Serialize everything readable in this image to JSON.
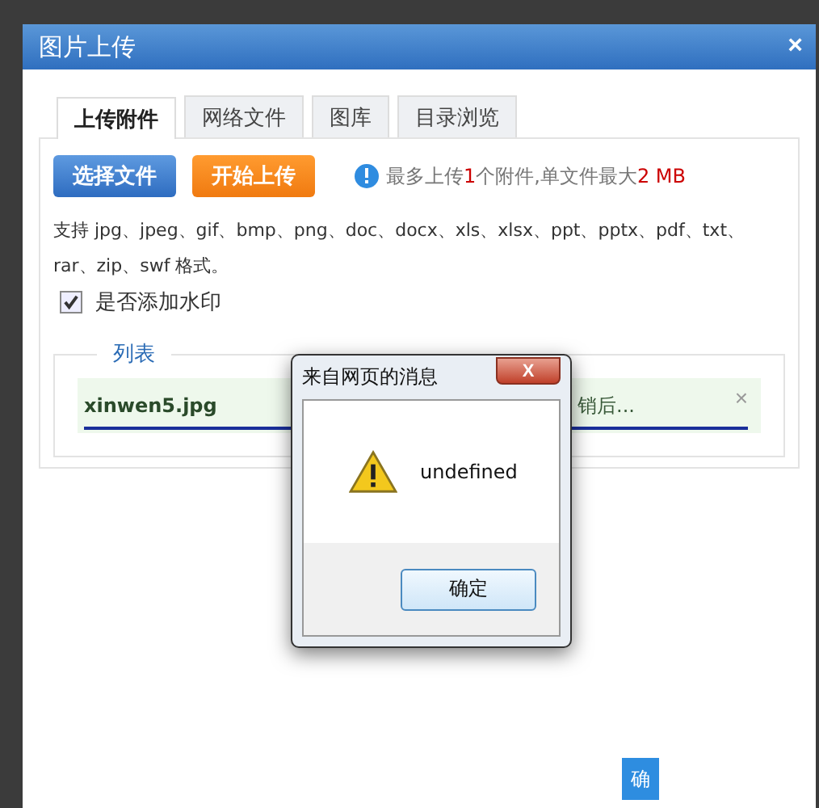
{
  "dialog": {
    "title": "图片上传",
    "close": "×"
  },
  "tabs": [
    {
      "label": "上传附件",
      "selected": true
    },
    {
      "label": "网络文件",
      "selected": false
    },
    {
      "label": "图库",
      "selected": false
    },
    {
      "label": "目录浏览",
      "selected": false
    }
  ],
  "buttons": [
    {
      "label": "选择文件",
      "kind": "primary"
    },
    {
      "label": "开始上传",
      "kind": "upload"
    }
  ],
  "limit_note": [
    {
      "text": "最多上传",
      "highlight": false
    },
    {
      "text": "1",
      "highlight": true
    },
    {
      "text": "个附件,单文件最大",
      "highlight": false
    },
    {
      "text": "2 MB",
      "highlight": true
    }
  ],
  "formats_note": "支持 jpg、jpeg、gif、bmp、png、doc、docx、xls、xlsx、ppt、pptx、pdf、txt、rar、zip、swf 格式。",
  "watermark_option": {
    "label": "是否添加水印",
    "checked": true
  },
  "list": {
    "legend": "列表",
    "files": [
      {
        "name": "xinwen5.jpg",
        "status": "销后...",
        "remove": "×",
        "level": 1
      }
    ]
  },
  "footer_button": "确",
  "alert": {
    "title": "来自网页的消息",
    "close": "X",
    "message": "undefined",
    "ok": "确定"
  }
}
